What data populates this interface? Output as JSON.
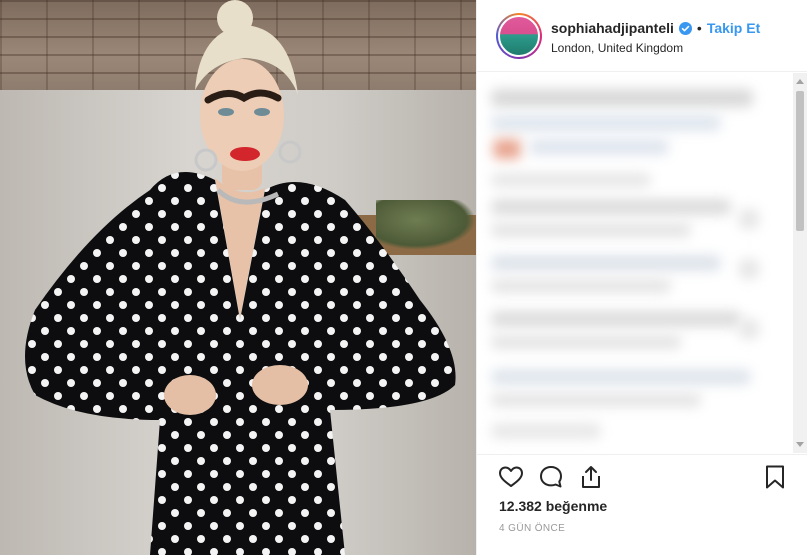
{
  "post": {
    "username": "sophiahadjipanteli",
    "separator": "•",
    "follow_label": "Takip Et",
    "location": "London, United Kingdom",
    "likes_text": "12.382 beğenme",
    "time_ago": "4 GÜN ÖNCE"
  },
  "colors": {
    "accent": "#3897f0",
    "text": "#262626",
    "muted": "#999999"
  },
  "icons": {
    "verified": "verified-badge-icon",
    "like": "heart-icon",
    "comment": "comment-bubble-icon",
    "share": "share-icon",
    "save": "bookmark-icon"
  }
}
